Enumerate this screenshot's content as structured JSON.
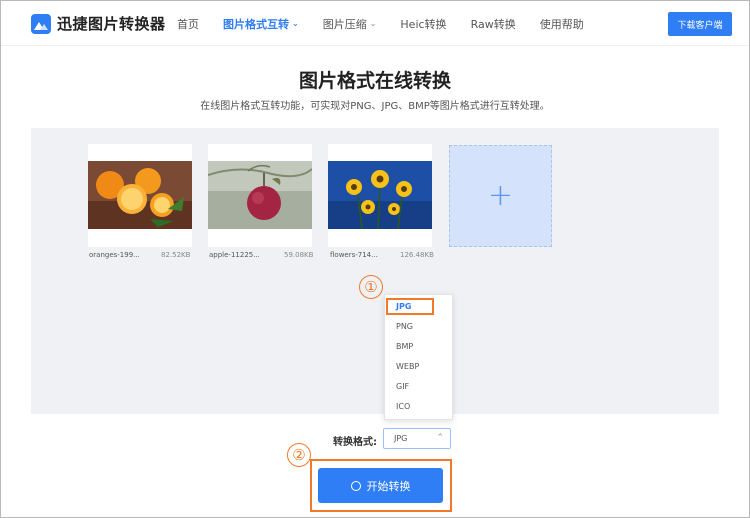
{
  "header": {
    "logo_text": "迅捷图片转换器",
    "nav": [
      {
        "label": "首页"
      },
      {
        "label": "图片格式互转",
        "has_dropdown": true,
        "active": true
      },
      {
        "label": "图片压缩",
        "has_dropdown": true
      },
      {
        "label": "Heic转换"
      },
      {
        "label": "Raw转换"
      },
      {
        "label": "使用帮助"
      }
    ],
    "download_label": "下载客户端"
  },
  "page": {
    "title": "图片格式在线转换",
    "subtitle": "在线图片格式互转功能，可实现对PNG、JPG、BMP等图片格式进行互转处理。"
  },
  "files": [
    {
      "name": "oranges-199...",
      "size": "82.52KB"
    },
    {
      "name": "apple-11225...",
      "size": "59.08KB"
    },
    {
      "name": "flowers-714...",
      "size": "126.48KB"
    }
  ],
  "add_button": "+",
  "annotations": {
    "step1": "①",
    "step2": "②"
  },
  "dropdown": {
    "options": [
      "JPG",
      "PNG",
      "BMP",
      "WEBP",
      "GIF",
      "ICO"
    ],
    "selected": "JPG"
  },
  "format": {
    "label": "转换格式:",
    "value": "JPG"
  },
  "start_button": "开始转换",
  "colors": {
    "accent": "#2f7ef5",
    "highlight": "#f07a2a",
    "workarea": "#f0f1f5"
  }
}
